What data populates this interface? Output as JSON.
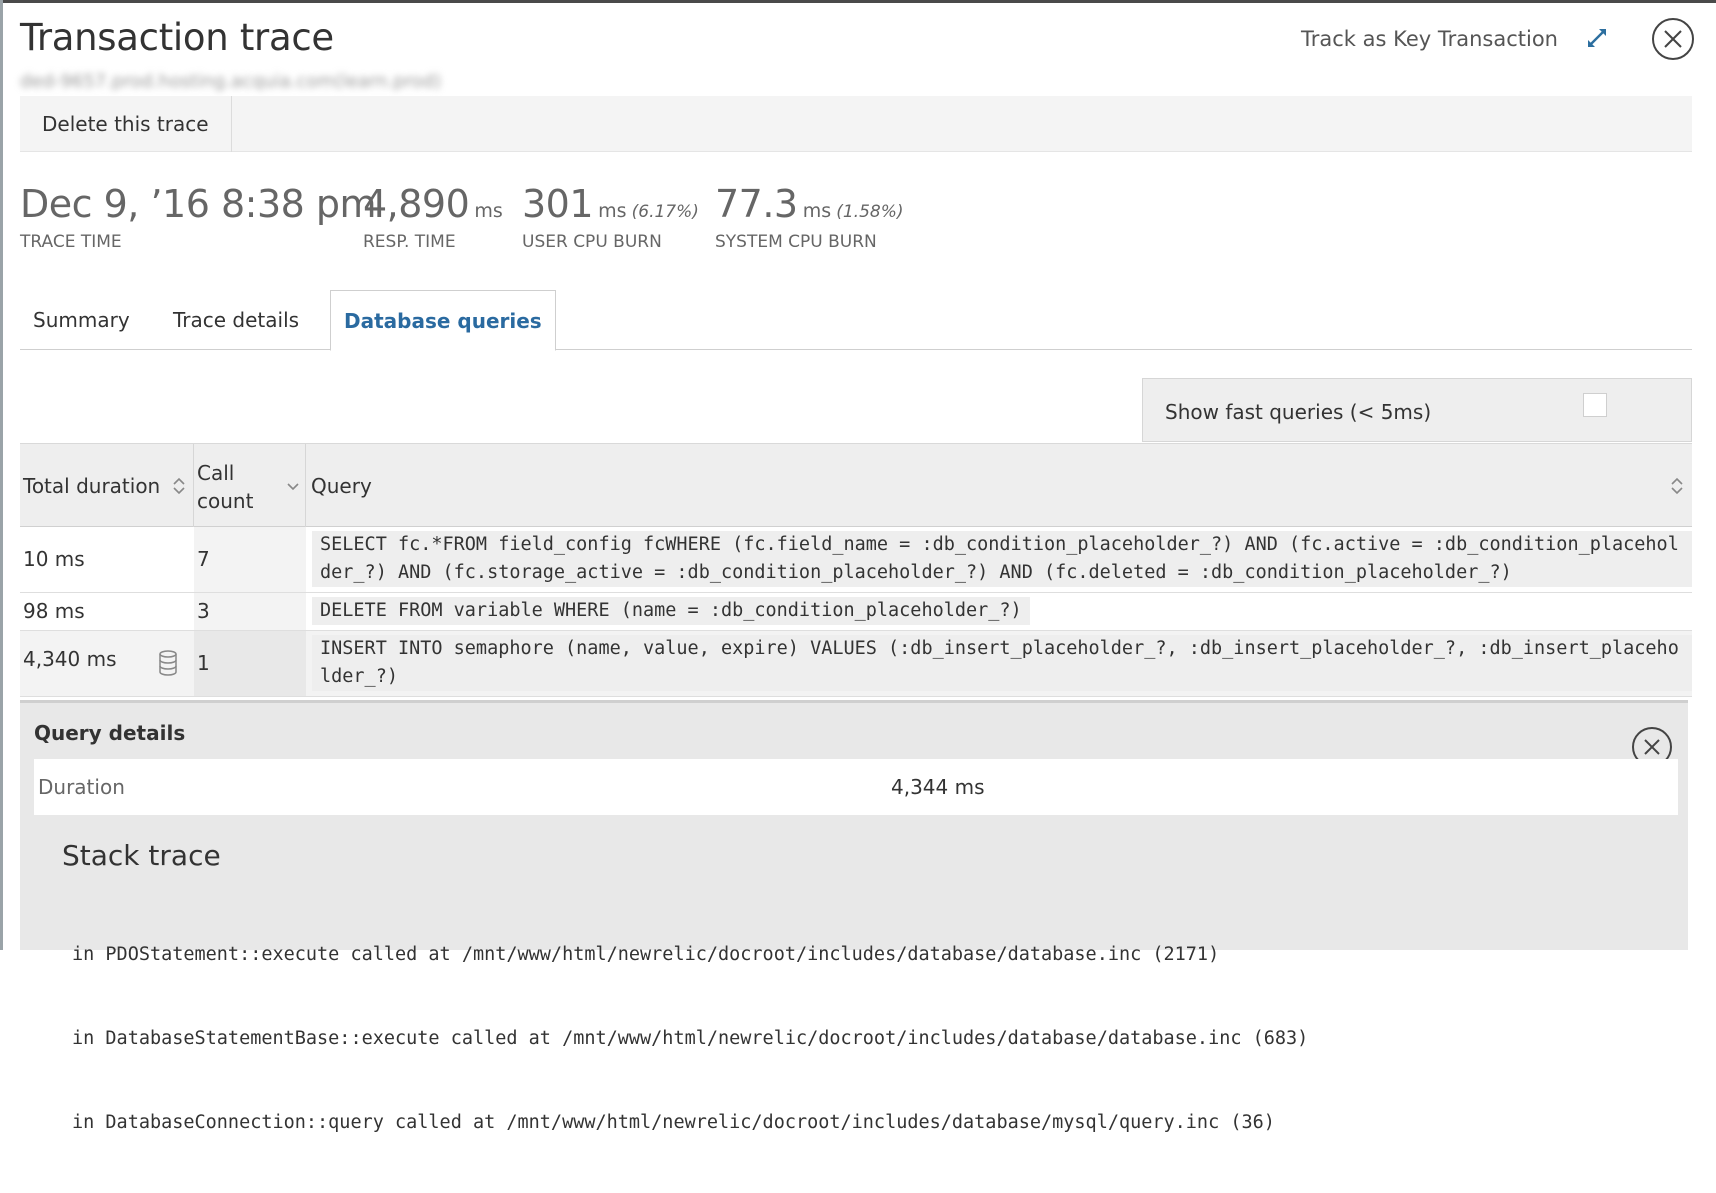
{
  "header": {
    "title": "Transaction trace",
    "subtitle": "ded-9657.prod.hosting.acquia.com(learn.prod)",
    "track_label": "Track as Key Transaction"
  },
  "actions": {
    "delete_label": "Delete this trace"
  },
  "stats": {
    "trace_time": {
      "value": "Dec 9, ’16 8:38 pm",
      "label": "TRACE TIME"
    },
    "resp_time": {
      "value": "4,890",
      "unit": "ms",
      "label": "RESP. TIME"
    },
    "user_cpu": {
      "value": "301",
      "unit": "ms",
      "pct": "(6.17%)",
      "label": "USER CPU BURN"
    },
    "system_cpu": {
      "value": "77.3",
      "unit": "ms",
      "pct": "(1.58%)",
      "label": "SYSTEM CPU BURN"
    }
  },
  "tabs": [
    {
      "label": "Summary",
      "active": false
    },
    {
      "label": "Trace details",
      "active": false
    },
    {
      "label": "Database queries",
      "active": true
    }
  ],
  "filter": {
    "show_fast_label": "Show fast queries (< 5ms)",
    "checked": false
  },
  "table": {
    "headers": {
      "duration": "Total duration",
      "call_count_line1": "Call",
      "call_count_line2": "count",
      "query": "Query"
    },
    "rows": [
      {
        "duration": "10 ms",
        "count": "7",
        "query": "SELECT fc.*FROM field_config fcWHERE (fc.field_name = :db_condition_placeholder_?) AND (fc.active = :db_condition_placeholder_?) AND (fc.storage_active = :db_condition_placeholder_?) AND (fc.deleted = :db_condition_placeholder_?)"
      },
      {
        "duration": "98 ms",
        "count": "3",
        "query": "DELETE FROM variable WHERE (name = :db_condition_placeholder_?)"
      },
      {
        "duration": "4,340 ms",
        "count": "1",
        "query": "INSERT INTO semaphore (name, value, expire) VALUES (:db_insert_placeholder_?, :db_insert_placeholder_?, :db_insert_placeholder_?)"
      }
    ]
  },
  "details": {
    "title": "Query details",
    "duration_label": "Duration",
    "duration_value": "4,344 ms",
    "stack_title": "Stack trace",
    "stack": [
      "in PDOStatement::execute called at /mnt/www/html/newrelic/docroot/includes/database/database.inc (2171)",
      "in DatabaseStatementBase::execute called at /mnt/www/html/newrelic/docroot/includes/database/database.inc (683)",
      "in DatabaseConnection::query called at /mnt/www/html/newrelic/docroot/includes/database/mysql/query.inc (36)"
    ]
  },
  "colors": {
    "active_tab": "#2a6aa0",
    "panel_bg": "#eeeeee"
  }
}
